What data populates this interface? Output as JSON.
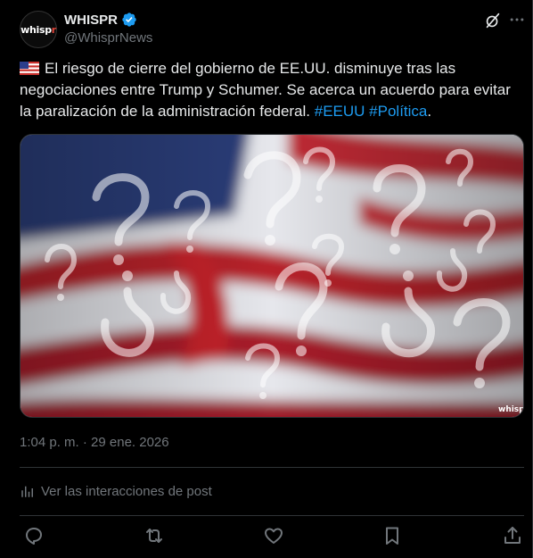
{
  "colors": {
    "accent": "#1d9bf0",
    "muted": "#71767b",
    "text": "#e7e9ea",
    "background": "#000000",
    "border": "#2f3336"
  },
  "author": {
    "avatar_text_main": "whisp",
    "avatar_text_accent": "r",
    "display_name": "WHISPR",
    "handle": "@WhisprNews",
    "verified": true
  },
  "header_icons": [
    "grok-icon",
    "more-icon"
  ],
  "post": {
    "flag": "us-flag-emoji",
    "body": "El riesgo de cierre del gobierno de EE.UU. disminuye tras las negociaciones entre Trump y Schumer. Se acerca un acuerdo para evitar la paralización de la administración federal.",
    "hashtags": [
      "#EEUU",
      "#Política"
    ],
    "trailing": ".",
    "media_watermark": "whispr"
  },
  "timestamp": "1:04 p. m. · 29 ene. 2026",
  "analytics": {
    "label": "Ver las interacciones de post",
    "icon": "analytics-icon"
  },
  "actions": [
    "reply-icon",
    "repost-icon",
    "like-icon",
    "bookmark-icon",
    "share-icon"
  ]
}
